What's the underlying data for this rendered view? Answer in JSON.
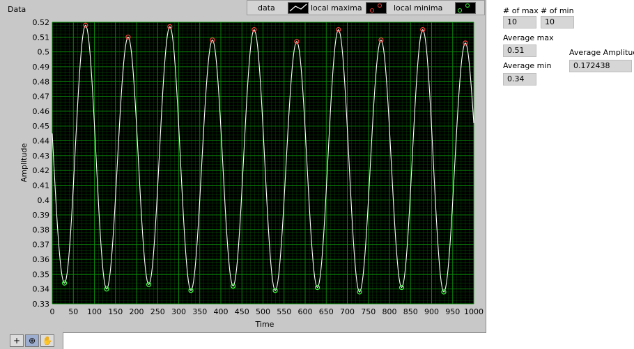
{
  "graph": {
    "title": "Data",
    "legend": [
      {
        "label": "data",
        "icon": "line-swatch-icon"
      },
      {
        "label": "local maxima",
        "icon": "red-circle-marker-icon"
      },
      {
        "label": "local minima",
        "icon": "green-circle-marker-icon"
      }
    ],
    "xlabel": "Time",
    "ylabel": "Amplitude",
    "colors": {
      "plot_bg": "#000000",
      "grid": "#0a8f0a",
      "trace": "#ffffff",
      "max_marker": "#ff4040",
      "min_marker": "#40ff40"
    }
  },
  "palette": {
    "tools": [
      {
        "name": "cursor-tool-icon",
        "glyph": "+"
      },
      {
        "name": "zoom-tool-icon",
        "glyph": "⊕"
      },
      {
        "name": "pan-hand-icon",
        "glyph": "✋"
      }
    ]
  },
  "indicators": {
    "num_max": {
      "label": "# of max",
      "value": "10"
    },
    "num_min": {
      "label": "# of min",
      "value": "10"
    },
    "avg_max": {
      "label": "Average max",
      "value": "0.51"
    },
    "avg_min": {
      "label": "Average min",
      "value": "0.34"
    },
    "avg_amp": {
      "label": "Average Amplitude",
      "value": "0.172438"
    }
  },
  "chart_data": {
    "type": "line",
    "title": "Data",
    "xlabel": "Time",
    "ylabel": "Amplitude",
    "xlim": [
      0,
      1000
    ],
    "ylim": [
      0.33,
      0.52
    ],
    "xticks": [
      "0",
      "50",
      "100",
      "150",
      "200",
      "250",
      "300",
      "350",
      "400",
      "450",
      "500",
      "550",
      "600",
      "650",
      "700",
      "750",
      "800",
      "850",
      "900",
      "950",
      "1000"
    ],
    "yticks": [
      "0.33",
      "0.34",
      "0.35",
      "0.36",
      "0.37",
      "0.38",
      "0.39",
      "0.4",
      "0.41",
      "0.42",
      "0.43",
      "0.44",
      "0.45",
      "0.46",
      "0.47",
      "0.48",
      "0.49",
      "0.5",
      "0.51",
      "0.52"
    ],
    "grid": true,
    "legend_position": "top",
    "series": [
      {
        "name": "data",
        "color": "#ffffff",
        "x": [
          0,
          1000
        ],
        "y": [
          0.445,
          0.452
        ]
      },
      {
        "name": "local maxima",
        "color": "#ff4040",
        "x": [
          79,
          180,
          279,
          380,
          479,
          580,
          679,
          780,
          879,
          980
        ],
        "y": [
          0.518,
          0.51,
          0.517,
          0.508,
          0.515,
          0.507,
          0.515,
          0.508,
          0.515,
          0.506
        ]
      },
      {
        "name": "local minima",
        "color": "#40ff40",
        "x": [
          29,
          129,
          229,
          329,
          429,
          529,
          629,
          729,
          829,
          929
        ],
        "y": [
          0.344,
          0.34,
          0.343,
          0.339,
          0.342,
          0.339,
          0.341,
          0.338,
          0.341,
          0.338
        ]
      }
    ]
  }
}
